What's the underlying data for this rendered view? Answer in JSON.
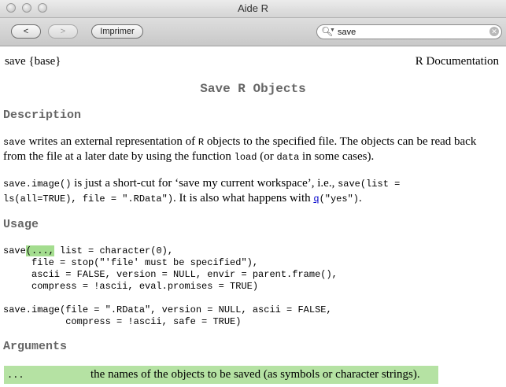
{
  "window": {
    "title": "Aide R"
  },
  "toolbar": {
    "back_label": "<",
    "forward_label": ">",
    "print_label": "Imprimer",
    "search_value": "save"
  },
  "doc": {
    "topic": "save {base}",
    "doc_source": "R Documentation",
    "title": "Save R Objects",
    "description_heading": "Description",
    "desc1": {
      "fn": "save",
      "t1": " writes an external representation of ",
      "r": "R",
      "t2": " objects to the specified file. The objects can be read back",
      "t3": "from the file at a later date by using the function ",
      "load": "load",
      "t4": " (or ",
      "data": "data",
      "t5": " in some cases)."
    },
    "desc2": {
      "fn": "save.image()",
      "t1": " is just a short-cut for ‘save my current workspace’, i.e., ",
      "code1": "save(list =",
      "code2": "ls(all=TRUE), file = \".RData\")",
      "t2": ". It is also what happens with ",
      "q": "q",
      "code3": "(\"yes\")",
      "t3": "."
    },
    "usage_heading": "Usage",
    "usage": {
      "line1_a": "save",
      "line1_hl": "(...,",
      "line1_b": " list = character(0),",
      "line2": "     file = stop(\"'file' must be specified\"),",
      "line3": "     ascii = FALSE, version = NULL, envir = parent.frame(),",
      "line4": "     compress = !ascii, eval.promises = TRUE)",
      "line5": "save.image(file = \".RData\", version = NULL, ascii = FALSE,",
      "line6": "           compress = !ascii, safe = TRUE)"
    },
    "arguments_heading": "Arguments",
    "arguments": [
      {
        "name": "...",
        "desc": "the names of the objects to be saved (as symbols or character strings)."
      }
    ]
  }
}
